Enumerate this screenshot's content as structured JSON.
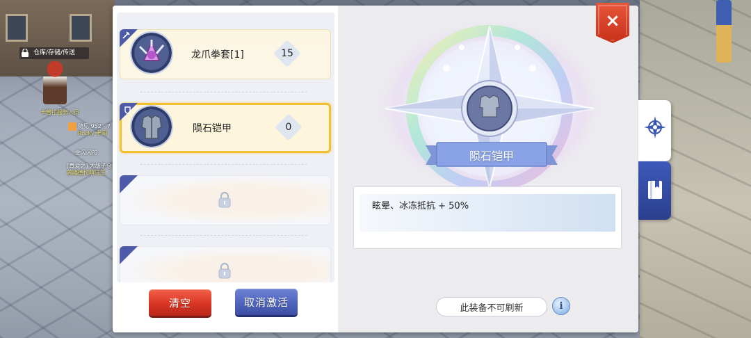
{
  "world": {
    "npc_menu_label": "仓库/存储/传送",
    "npc_name": "卡普拉服务人员",
    "chat_lines": [
      "随见 952 - 7",
      "Rocky 老哥",
      "金闪闪的",
      "[真爱之] 大胡子仓",
      "普隆德拉萌汪王"
    ]
  },
  "slots": [
    {
      "name": "龙爪拳套[1]",
      "count": "15",
      "state": "filled",
      "icon": "dragon-claw-gauntlet-icon",
      "corner_icon": "weapon-icon"
    },
    {
      "name": "陨石铠甲",
      "count": "0",
      "state": "selected",
      "icon": "meteor-armor-icon",
      "corner_icon": "armor-icon"
    },
    {
      "state": "locked",
      "icon": "lock-icon"
    },
    {
      "state": "locked",
      "icon": "lock-icon"
    }
  ],
  "buttons": {
    "clear": "清空",
    "cancel_activation": "取消激活"
  },
  "detail": {
    "item_name": "陨石铠甲",
    "effect": "眩晕、冰冻抵抗 + 50%",
    "refresh_note": "此装备不可刷新",
    "info": "i"
  },
  "close": "×",
  "side_tabs": [
    {
      "icon": "compass-icon",
      "active": true
    },
    {
      "icon": "book-icon",
      "active": false
    }
  ],
  "colors": {
    "accent_gold": "#f4c232",
    "accent_blue": "#4d5aa8",
    "close_red": "#d63f25",
    "banner_blue": "#8aa3e6"
  }
}
